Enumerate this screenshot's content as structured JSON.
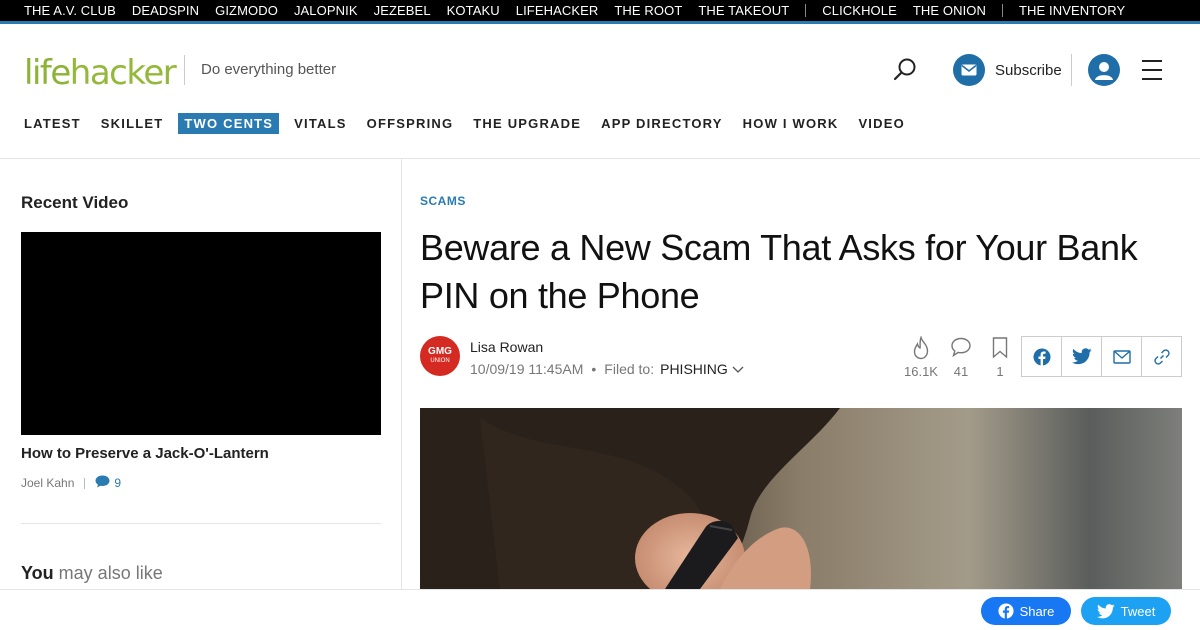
{
  "network": {
    "links_group1": [
      "THE A.V. CLUB",
      "DEADSPIN",
      "GIZMODO",
      "JALOPNIK",
      "JEZEBEL",
      "KOTAKU",
      "LIFEHACKER",
      "THE ROOT",
      "THE TAKEOUT"
    ],
    "links_group2": [
      "CLICKHOLE",
      "THE ONION"
    ],
    "links_group3": [
      "THE INVENTORY"
    ],
    "accent_color": "#2a7bb2"
  },
  "header": {
    "logo_text_part1": "life",
    "logo_text_part2": "hacker",
    "logo_color": "#94b83a",
    "tagline": "Do everything better",
    "subscribe_label": "Subscribe"
  },
  "section_nav": {
    "items": [
      "LATEST",
      "SKILLET",
      "TWO CENTS",
      "VITALS",
      "OFFSPRING",
      "THE UPGRADE",
      "APP DIRECTORY",
      "HOW I WORK",
      "VIDEO"
    ],
    "active": "TWO CENTS"
  },
  "rail": {
    "title": "Recent Video",
    "video_title": "How to Preserve a Jack-O'-Lantern",
    "video_author": "Joel Kahn",
    "video_comments": "9",
    "also_like_bold": "You",
    "also_like_rest": " may also like"
  },
  "article": {
    "kicker": "SCAMS",
    "headline": "Beware a New Scam That Asks for Your Bank PIN on the Phone",
    "author_avatar_line1": "GMG",
    "author_avatar_line2": "UNION",
    "author": "Lisa Rowan",
    "timestamp": "10/09/19 11:45AM",
    "filed_to_label": "Filed to:",
    "filed_to_tag": "PHISHING",
    "stats": {
      "views": "16.1K",
      "comments": "41",
      "bookmarks": "1"
    }
  },
  "bottom_bar": {
    "share_label": "Share",
    "tweet_label": "Tweet"
  }
}
